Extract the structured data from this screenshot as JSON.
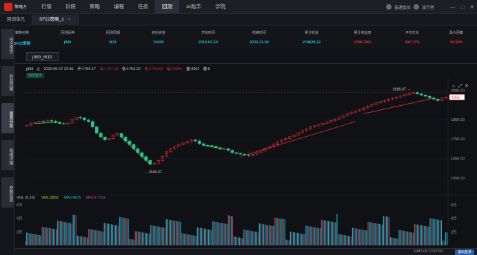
{
  "app": {
    "logo_text": "策略方",
    "nav": [
      "行情",
      "训练",
      "策略",
      "编程",
      "任务",
      "回测",
      "AI助手",
      "学院"
    ],
    "active_nav": "回测",
    "user_label": "普通会员",
    "user_name": "旅行者",
    "win_controls": [
      "—",
      "□",
      "✕"
    ]
  },
  "tabs": [
    {
      "label": "回测单元",
      "active": false
    },
    {
      "label": "SF22策略_1",
      "active": true,
      "close": "×"
    }
  ],
  "sidebar": [
    "综合报告",
    "收益回撤",
    "图表分析",
    "明细详情",
    "参数信息"
  ],
  "sidebar_active": "图表分析",
  "summary": {
    "headers": [
      "策略名称",
      "回测品种",
      "回测周期",
      "初始资金",
      "开始时间",
      "结束时间",
      "累计收益",
      "累计收益率",
      "平均年化",
      "最大回撤"
    ],
    "values": [
      "SF22策略",
      "j999",
      "M15",
      "10000",
      "2015-03-10",
      "2020-11-06",
      "278828.22",
      "2786.28%",
      "492.37%",
      "30.68%"
    ]
  },
  "symbol_button": "j999_M15",
  "info": {
    "symbol": "j999",
    "bracket": "()",
    "datetime": "2020-05-07  22:45",
    "open": "开:1755.17",
    "high": "高:1757.13",
    "low": "低:1754.22",
    "close": "收:1756.62",
    "change": "幅:0.08%",
    "volume": "量:3302",
    "oi": "额:0"
  },
  "tag_badge": "回测显示",
  "chart_data": [
    {
      "type": "line",
      "title": "j999 M15 price",
      "ylim": [
        1500,
        2030
      ],
      "y_ticks": [
        "2000.00",
        "1850.00",
        "1750.00",
        "1650.00",
        "1550.00"
      ],
      "y_tick_values": [
        2000,
        1850,
        1750,
        1650,
        1550
      ],
      "series": [
        {
          "name": "price",
          "values": [
            1820,
            1830,
            1835,
            1840,
            1838,
            1845,
            1842,
            1836,
            1830,
            1828,
            1832,
            1850,
            1862,
            1858,
            1848,
            1840,
            1812,
            1780,
            1760,
            1745,
            1752,
            1770,
            1778,
            1760,
            1740,
            1722,
            1700,
            1680,
            1660,
            1640,
            1620,
            1625,
            1640,
            1662,
            1684,
            1700,
            1712,
            1722,
            1730,
            1736,
            1745,
            1740,
            1726,
            1718,
            1716,
            1712,
            1705,
            1698,
            1700,
            1692,
            1680,
            1676,
            1672,
            1668,
            1665,
            1672,
            1680,
            1690,
            1702,
            1710,
            1722,
            1734,
            1745,
            1752,
            1762,
            1770,
            1782,
            1794,
            1802,
            1812,
            1818,
            1822,
            1830,
            1838,
            1845,
            1852,
            1860,
            1870,
            1880,
            1888,
            1895,
            1900,
            1910,
            1920,
            1928,
            1936,
            1942,
            1948,
            1955,
            1960,
            1965,
            1972,
            1978,
            1984,
            1989,
            1982,
            1976,
            1970,
            1962,
            1955,
            1948,
            1960,
            1965
          ]
        }
      ],
      "annotations": [
        "1989.07",
        "1596.51"
      ],
      "last_price": "1965",
      "ref_line": 1989
    },
    {
      "type": "bar",
      "title": "VOL (5,10)",
      "legend": [
        "VOL:3302",
        "MA5:4675",
        "MA10:7752"
      ],
      "y_ticks": [
        "6万",
        "4万",
        "2万"
      ],
      "y_tick_values": [
        60000,
        40000,
        20000
      ],
      "ylim": [
        0,
        65000
      ]
    }
  ],
  "status": {
    "time": "GMT+8 17:52:59",
    "button": "退出登录"
  },
  "colors": {
    "up": "#e03030",
    "down": "#2ec38b",
    "accent_cyan": "#16c0d8",
    "trend_line": "#e03030",
    "green_trend": "#4ac94a"
  }
}
